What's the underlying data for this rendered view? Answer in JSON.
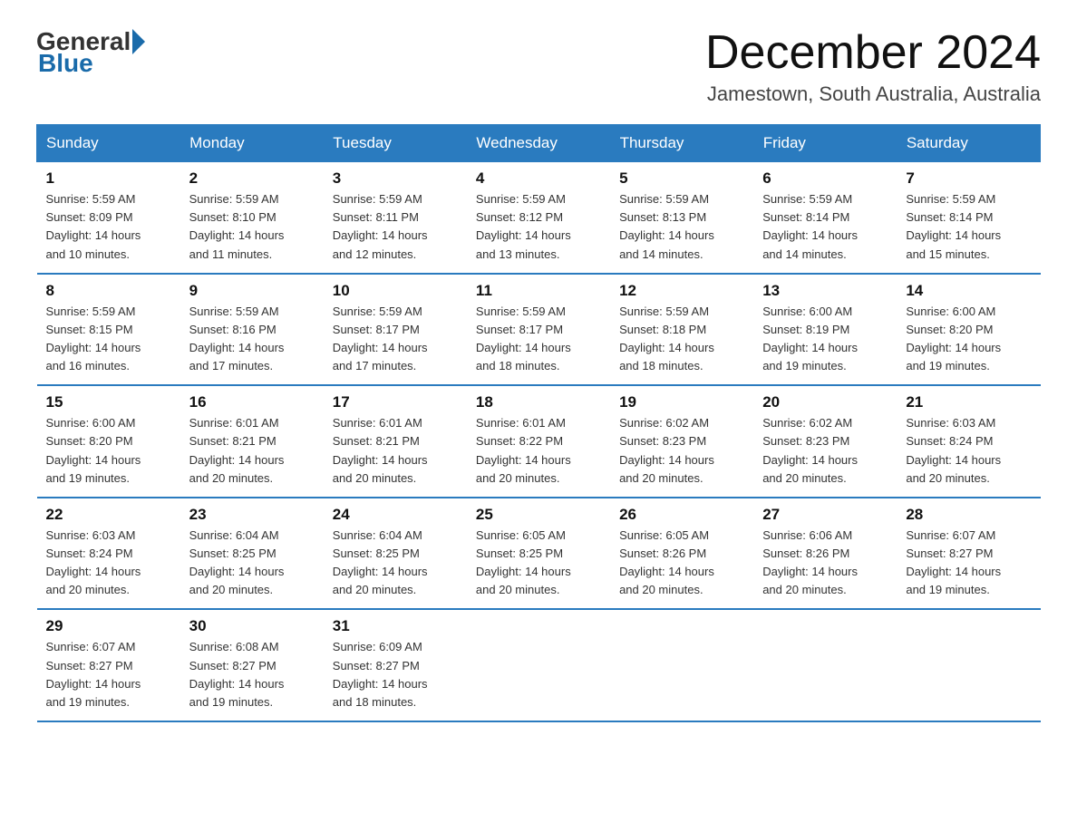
{
  "header": {
    "logo_general": "General",
    "logo_blue": "Blue",
    "month_title": "December 2024",
    "location": "Jamestown, South Australia, Australia"
  },
  "weekdays": [
    "Sunday",
    "Monday",
    "Tuesday",
    "Wednesday",
    "Thursday",
    "Friday",
    "Saturday"
  ],
  "weeks": [
    [
      {
        "day": "1",
        "sunrise": "5:59 AM",
        "sunset": "8:09 PM",
        "daylight": "14 hours and 10 minutes."
      },
      {
        "day": "2",
        "sunrise": "5:59 AM",
        "sunset": "8:10 PM",
        "daylight": "14 hours and 11 minutes."
      },
      {
        "day": "3",
        "sunrise": "5:59 AM",
        "sunset": "8:11 PM",
        "daylight": "14 hours and 12 minutes."
      },
      {
        "day": "4",
        "sunrise": "5:59 AM",
        "sunset": "8:12 PM",
        "daylight": "14 hours and 13 minutes."
      },
      {
        "day": "5",
        "sunrise": "5:59 AM",
        "sunset": "8:13 PM",
        "daylight": "14 hours and 14 minutes."
      },
      {
        "day": "6",
        "sunrise": "5:59 AM",
        "sunset": "8:14 PM",
        "daylight": "14 hours and 14 minutes."
      },
      {
        "day": "7",
        "sunrise": "5:59 AM",
        "sunset": "8:14 PM",
        "daylight": "14 hours and 15 minutes."
      }
    ],
    [
      {
        "day": "8",
        "sunrise": "5:59 AM",
        "sunset": "8:15 PM",
        "daylight": "14 hours and 16 minutes."
      },
      {
        "day": "9",
        "sunrise": "5:59 AM",
        "sunset": "8:16 PM",
        "daylight": "14 hours and 17 minutes."
      },
      {
        "day": "10",
        "sunrise": "5:59 AM",
        "sunset": "8:17 PM",
        "daylight": "14 hours and 17 minutes."
      },
      {
        "day": "11",
        "sunrise": "5:59 AM",
        "sunset": "8:17 PM",
        "daylight": "14 hours and 18 minutes."
      },
      {
        "day": "12",
        "sunrise": "5:59 AM",
        "sunset": "8:18 PM",
        "daylight": "14 hours and 18 minutes."
      },
      {
        "day": "13",
        "sunrise": "6:00 AM",
        "sunset": "8:19 PM",
        "daylight": "14 hours and 19 minutes."
      },
      {
        "day": "14",
        "sunrise": "6:00 AM",
        "sunset": "8:20 PM",
        "daylight": "14 hours and 19 minutes."
      }
    ],
    [
      {
        "day": "15",
        "sunrise": "6:00 AM",
        "sunset": "8:20 PM",
        "daylight": "14 hours and 19 minutes."
      },
      {
        "day": "16",
        "sunrise": "6:01 AM",
        "sunset": "8:21 PM",
        "daylight": "14 hours and 20 minutes."
      },
      {
        "day": "17",
        "sunrise": "6:01 AM",
        "sunset": "8:21 PM",
        "daylight": "14 hours and 20 minutes."
      },
      {
        "day": "18",
        "sunrise": "6:01 AM",
        "sunset": "8:22 PM",
        "daylight": "14 hours and 20 minutes."
      },
      {
        "day": "19",
        "sunrise": "6:02 AM",
        "sunset": "8:23 PM",
        "daylight": "14 hours and 20 minutes."
      },
      {
        "day": "20",
        "sunrise": "6:02 AM",
        "sunset": "8:23 PM",
        "daylight": "14 hours and 20 minutes."
      },
      {
        "day": "21",
        "sunrise": "6:03 AM",
        "sunset": "8:24 PM",
        "daylight": "14 hours and 20 minutes."
      }
    ],
    [
      {
        "day": "22",
        "sunrise": "6:03 AM",
        "sunset": "8:24 PM",
        "daylight": "14 hours and 20 minutes."
      },
      {
        "day": "23",
        "sunrise": "6:04 AM",
        "sunset": "8:25 PM",
        "daylight": "14 hours and 20 minutes."
      },
      {
        "day": "24",
        "sunrise": "6:04 AM",
        "sunset": "8:25 PM",
        "daylight": "14 hours and 20 minutes."
      },
      {
        "day": "25",
        "sunrise": "6:05 AM",
        "sunset": "8:25 PM",
        "daylight": "14 hours and 20 minutes."
      },
      {
        "day": "26",
        "sunrise": "6:05 AM",
        "sunset": "8:26 PM",
        "daylight": "14 hours and 20 minutes."
      },
      {
        "day": "27",
        "sunrise": "6:06 AM",
        "sunset": "8:26 PM",
        "daylight": "14 hours and 20 minutes."
      },
      {
        "day": "28",
        "sunrise": "6:07 AM",
        "sunset": "8:27 PM",
        "daylight": "14 hours and 19 minutes."
      }
    ],
    [
      {
        "day": "29",
        "sunrise": "6:07 AM",
        "sunset": "8:27 PM",
        "daylight": "14 hours and 19 minutes."
      },
      {
        "day": "30",
        "sunrise": "6:08 AM",
        "sunset": "8:27 PM",
        "daylight": "14 hours and 19 minutes."
      },
      {
        "day": "31",
        "sunrise": "6:09 AM",
        "sunset": "8:27 PM",
        "daylight": "14 hours and 18 minutes."
      },
      null,
      null,
      null,
      null
    ]
  ],
  "labels": {
    "sunrise_prefix": "Sunrise: ",
    "sunset_prefix": "Sunset: ",
    "daylight_prefix": "Daylight: "
  }
}
